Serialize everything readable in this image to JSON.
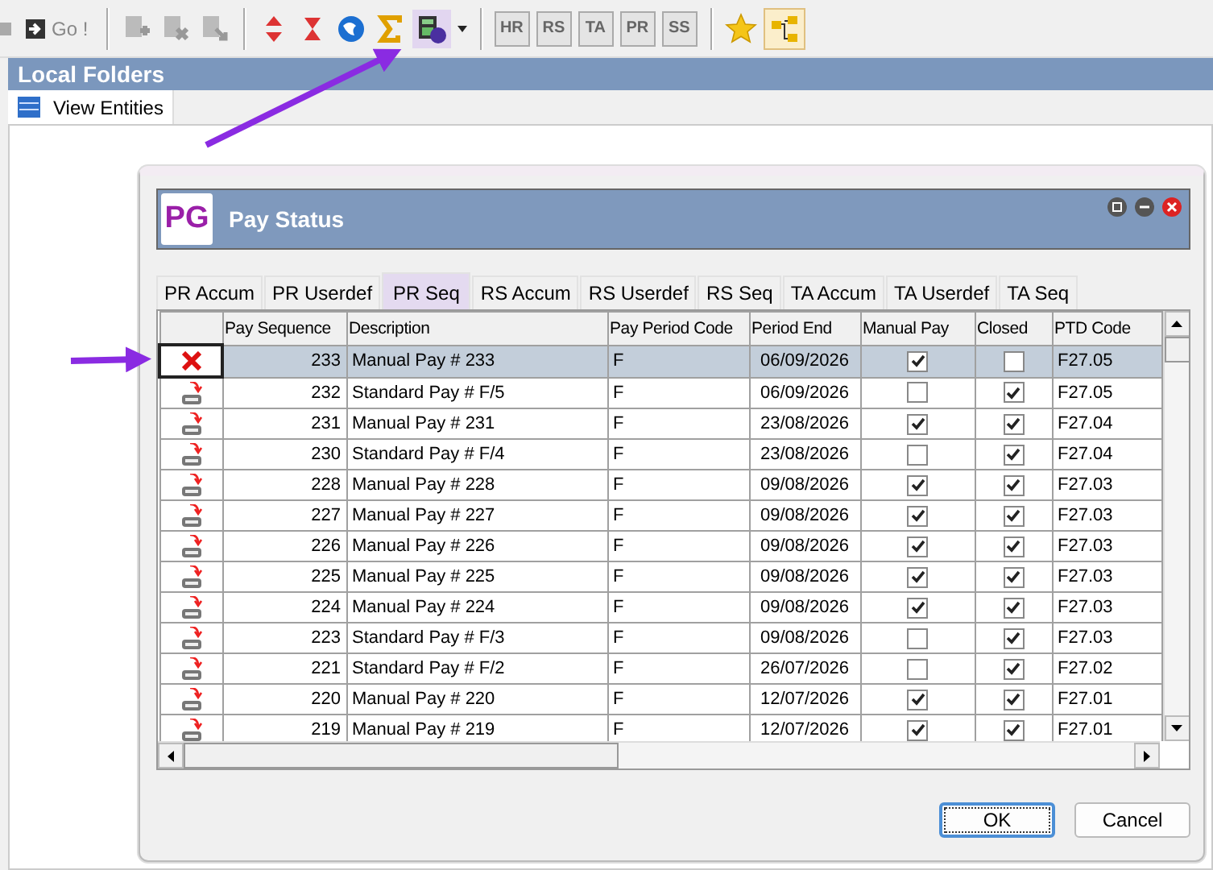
{
  "toolbar": {
    "go_button": {
      "label": "Go !",
      "disabled": true
    },
    "module_buttons": [
      {
        "label": "HR",
        "disabled": true
      },
      {
        "label": "RS",
        "disabled": true
      },
      {
        "label": "TA",
        "disabled": true
      },
      {
        "label": "PR",
        "disabled": true
      },
      {
        "label": "SS",
        "disabled": true
      }
    ]
  },
  "panel": {
    "title": "Local Folders",
    "tab": "View Entities"
  },
  "dialog": {
    "logo": "PG",
    "title": "Pay Status",
    "tabs": [
      {
        "label": "PR Accum",
        "selected": false
      },
      {
        "label": "PR Userdef",
        "selected": false
      },
      {
        "label": "PR Seq",
        "selected": true
      },
      {
        "label": "RS Accum",
        "selected": false
      },
      {
        "label": "RS Userdef",
        "selected": false
      },
      {
        "label": "RS Seq",
        "selected": false
      },
      {
        "label": "TA Accum",
        "selected": false
      },
      {
        "label": "TA Userdef",
        "selected": false
      },
      {
        "label": "TA Seq",
        "selected": false
      }
    ],
    "table": {
      "columns": [
        "Pay Sequence",
        "Description",
        "Pay Period Code",
        "Period End",
        "Manual Pay",
        "Closed",
        "PTD Code"
      ],
      "rows": [
        {
          "selected": true,
          "seq": "233",
          "description": "Manual Pay # 233",
          "period_code": "F",
          "period_end": "06/09/2026",
          "manual_pay": true,
          "closed": false,
          "ptd_code": "F27.05"
        },
        {
          "selected": false,
          "seq": "232",
          "description": "Standard Pay # F/5",
          "period_code": "F",
          "period_end": "06/09/2026",
          "manual_pay": false,
          "closed": true,
          "ptd_code": "F27.05"
        },
        {
          "selected": false,
          "seq": "231",
          "description": "Manual Pay # 231",
          "period_code": "F",
          "period_end": "23/08/2026",
          "manual_pay": true,
          "closed": true,
          "ptd_code": "F27.04"
        },
        {
          "selected": false,
          "seq": "230",
          "description": "Standard Pay # F/4",
          "period_code": "F",
          "period_end": "23/08/2026",
          "manual_pay": false,
          "closed": true,
          "ptd_code": "F27.04"
        },
        {
          "selected": false,
          "seq": "228",
          "description": "Manual Pay # 228",
          "period_code": "F",
          "period_end": "09/08/2026",
          "manual_pay": true,
          "closed": true,
          "ptd_code": "F27.03"
        },
        {
          "selected": false,
          "seq": "227",
          "description": "Manual Pay # 227",
          "period_code": "F",
          "period_end": "09/08/2026",
          "manual_pay": true,
          "closed": true,
          "ptd_code": "F27.03"
        },
        {
          "selected": false,
          "seq": "226",
          "description": "Manual Pay # 226",
          "period_code": "F",
          "period_end": "09/08/2026",
          "manual_pay": true,
          "closed": true,
          "ptd_code": "F27.03"
        },
        {
          "selected": false,
          "seq": "225",
          "description": "Manual Pay # 225",
          "period_code": "F",
          "period_end": "09/08/2026",
          "manual_pay": true,
          "closed": true,
          "ptd_code": "F27.03"
        },
        {
          "selected": false,
          "seq": "224",
          "description": "Manual Pay # 224",
          "period_code": "F",
          "period_end": "09/08/2026",
          "manual_pay": true,
          "closed": true,
          "ptd_code": "F27.03"
        },
        {
          "selected": false,
          "seq": "223",
          "description": "Standard Pay # F/3",
          "period_code": "F",
          "period_end": "09/08/2026",
          "manual_pay": false,
          "closed": true,
          "ptd_code": "F27.03"
        },
        {
          "selected": false,
          "seq": "221",
          "description": "Standard Pay # F/2",
          "period_code": "F",
          "period_end": "26/07/2026",
          "manual_pay": false,
          "closed": true,
          "ptd_code": "F27.02"
        },
        {
          "selected": false,
          "seq": "220",
          "description": "Manual Pay # 220",
          "period_code": "F",
          "period_end": "12/07/2026",
          "manual_pay": true,
          "closed": true,
          "ptd_code": "F27.01"
        },
        {
          "selected": false,
          "seq": "219",
          "description": "Manual Pay # 219",
          "period_code": "F",
          "period_end": "12/07/2026",
          "manual_pay": true,
          "closed": true,
          "ptd_code": "F27.01"
        }
      ]
    },
    "buttons": [
      "OK",
      "Cancel"
    ]
  }
}
